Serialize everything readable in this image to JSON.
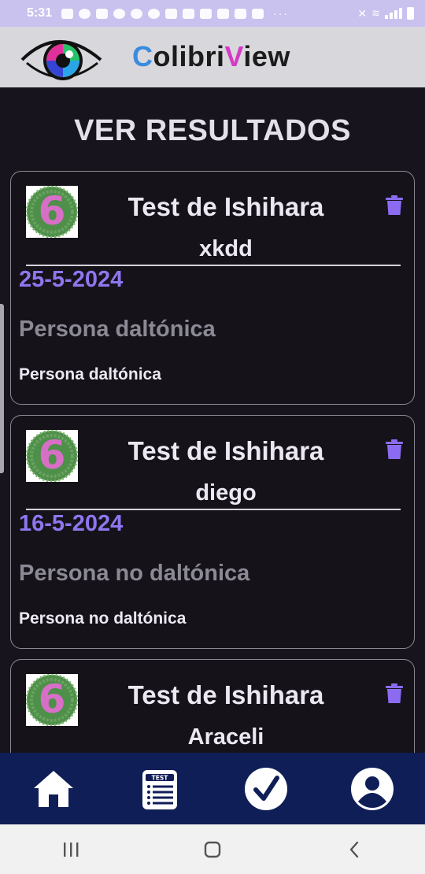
{
  "status_bar": {
    "time": "5:31",
    "overflow": "···"
  },
  "app": {
    "brand_first": "C",
    "brand_mid": "olibri",
    "brand_v": "V",
    "brand_end": "iew",
    "logo_icon": "eye-logo-icon"
  },
  "page": {
    "title": "VER RESULTADOS"
  },
  "results": [
    {
      "test": "Test de Ishihara",
      "user": "xkdd",
      "date": "25-5-2024",
      "result": "Persona daltónica",
      "detail": "Persona daltónica"
    },
    {
      "test": "Test de Ishihara",
      "user": "diego",
      "date": "16-5-2024",
      "result": "Persona no daltónica",
      "detail": "Persona no daltónica"
    },
    {
      "test": "Test de Ishihara",
      "user": "Araceli"
    }
  ],
  "bottom_nav": {
    "items": [
      "home-icon",
      "test-list-icon",
      "check-icon",
      "profile-icon"
    ]
  },
  "colors": {
    "accent": "#8f76ee",
    "nav_bg": "#0f1e57",
    "status_bar_bg": "#c9c1ee",
    "trash": "#8b6cf0"
  }
}
